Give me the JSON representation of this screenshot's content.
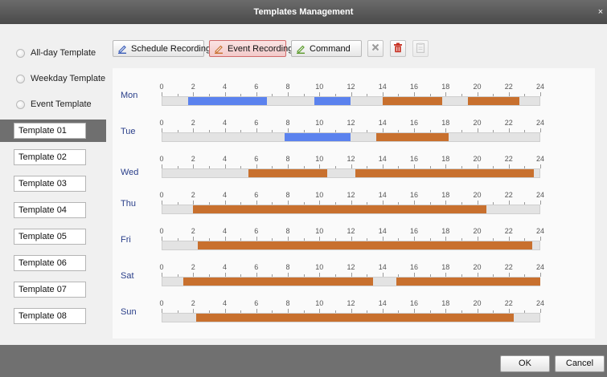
{
  "window": {
    "title": "Templates Management",
    "close_glyph": "×"
  },
  "sidebar": {
    "radios": [
      {
        "label": "All-day Template"
      },
      {
        "label": "Weekday Template"
      },
      {
        "label": "Event Template"
      }
    ],
    "templates": [
      {
        "label": "Template 01",
        "selected": true
      },
      {
        "label": "Template 02"
      },
      {
        "label": "Template 03"
      },
      {
        "label": "Template 04"
      },
      {
        "label": "Template 05"
      },
      {
        "label": "Template 06"
      },
      {
        "label": "Template 07"
      },
      {
        "label": "Template 08"
      }
    ]
  },
  "toolbar": {
    "schedule_label": "Schedule Recording",
    "event_label": "Event Recording",
    "command_label": "Command",
    "icons": [
      "delete-x-icon",
      "trash-icon",
      "clipboard-icon"
    ]
  },
  "colors": {
    "schedule": "#5b82ee",
    "event": "#c8702e",
    "track": "#e3e3e3",
    "day_label": "#2a3f8a"
  },
  "schedule": {
    "hours": [
      "0",
      "2",
      "4",
      "6",
      "8",
      "10",
      "12",
      "14",
      "16",
      "18",
      "20",
      "22",
      "24"
    ],
    "days": [
      {
        "label": "Mon",
        "segments": [
          {
            "type": "schedule",
            "start": 1.7,
            "end": 6.7
          },
          {
            "type": "schedule",
            "start": 9.7,
            "end": 12.0
          },
          {
            "type": "event",
            "start": 14.0,
            "end": 17.8
          },
          {
            "type": "event",
            "start": 19.4,
            "end": 22.7
          }
        ]
      },
      {
        "label": "Tue",
        "segments": [
          {
            "type": "schedule",
            "start": 7.8,
            "end": 12.0
          },
          {
            "type": "event",
            "start": 13.6,
            "end": 18.2
          }
        ]
      },
      {
        "label": "Wed",
        "segments": [
          {
            "type": "event",
            "start": 5.5,
            "end": 10.5
          },
          {
            "type": "event",
            "start": 12.3,
            "end": 23.6
          }
        ]
      },
      {
        "label": "Thu",
        "segments": [
          {
            "type": "event",
            "start": 2.0,
            "end": 20.6
          }
        ]
      },
      {
        "label": "Fri",
        "segments": [
          {
            "type": "event",
            "start": 2.3,
            "end": 23.5
          }
        ]
      },
      {
        "label": "Sat",
        "segments": [
          {
            "type": "event",
            "start": 1.4,
            "end": 13.4
          },
          {
            "type": "event",
            "start": 14.9,
            "end": 24.0
          }
        ]
      },
      {
        "label": "Sun",
        "segments": [
          {
            "type": "event",
            "start": 2.2,
            "end": 22.3
          }
        ]
      }
    ]
  },
  "footer": {
    "ok_label": "OK",
    "cancel_label": "Cancel"
  }
}
